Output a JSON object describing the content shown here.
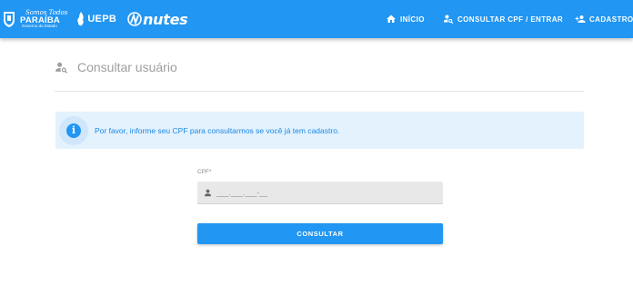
{
  "header": {
    "logos": {
      "paraiba_script": "Somos Todos",
      "paraiba_name": "PARAÍBA",
      "paraiba_sub": "Governo do Estado",
      "uepb": "UEPB",
      "nutes": "nutes"
    },
    "nav": {
      "home": {
        "label": "INÍCIO",
        "icon": "home-icon"
      },
      "cpf": {
        "label": "CONSULTAR CPF / ENTRAR",
        "icon": "person-search-icon"
      },
      "register": {
        "label": "CADASTRO",
        "icon": "person-add-icon"
      }
    },
    "color": "#2196f3"
  },
  "page": {
    "title": "Consultar usuário",
    "title_icon": "person-search-icon"
  },
  "alert": {
    "icon": "info-icon",
    "text": "Por favor, informe seu CPF para consultarmos se você já tem cadastro."
  },
  "form": {
    "cpf_label": "CPF*",
    "cpf_placeholder": "___.___.___-__",
    "cpf_value": "",
    "cpf_icon": "person-icon",
    "submit_label": "CONSULTAR"
  }
}
